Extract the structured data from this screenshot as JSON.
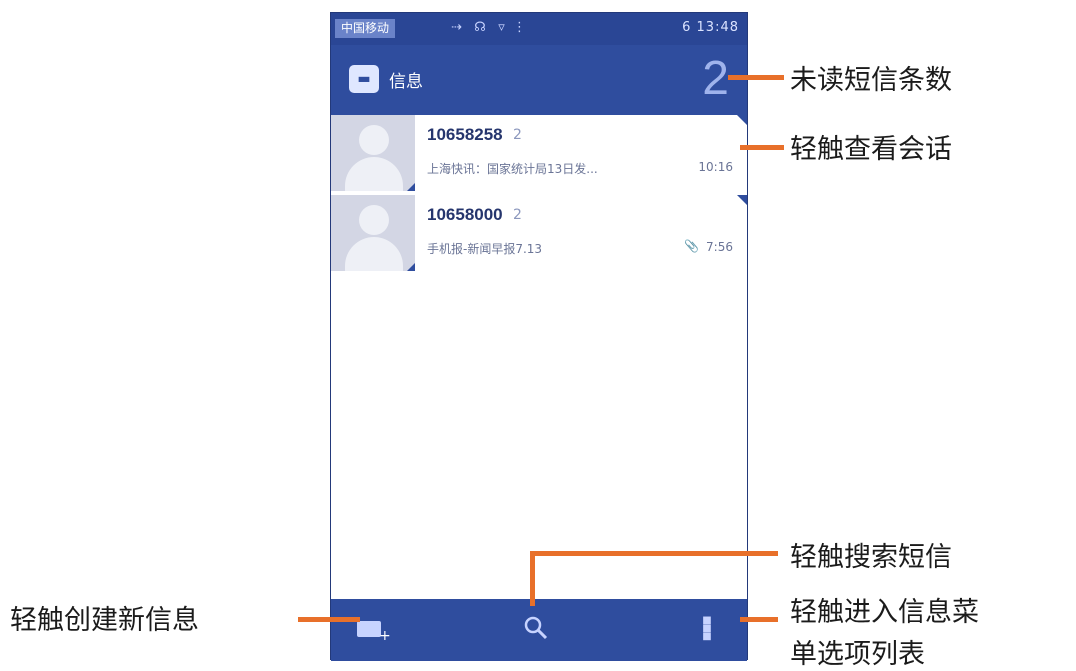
{
  "status_bar": {
    "carrier": "中国移动",
    "right_text": "6   13:48"
  },
  "action_bar": {
    "title": "信息",
    "unread_count": "2"
  },
  "conversations": [
    {
      "sender": "10658258",
      "count": "2",
      "snippet": "上海快讯：国家统计局13日发...",
      "time": "10:16",
      "attachment": ""
    },
    {
      "sender": "10658000",
      "count": "2",
      "snippet": "手机报-新闻早报7.13",
      "time": "7:56",
      "attachment": "📎"
    }
  ],
  "callouts": {
    "unread": "未读短信条数",
    "open_conversation": "轻触查看会话",
    "search": "轻触搜索短信",
    "menu_line1": "轻触进入信息菜",
    "menu_line2": "单选项列表",
    "compose": "轻触创建新信息"
  },
  "colors": {
    "bar_blue": "#2f4d9e",
    "callout_orange": "#e8702a"
  }
}
